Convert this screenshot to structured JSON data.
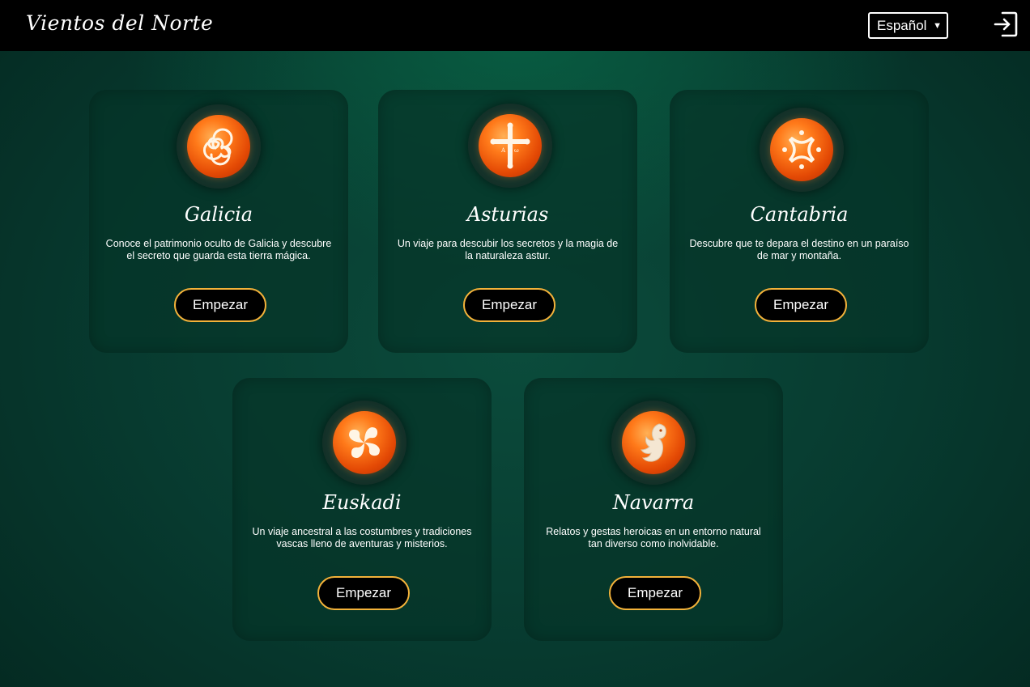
{
  "header": {
    "title": "Vientos del Norte",
    "language": "Español",
    "login_icon": "login-icon"
  },
  "regions": [
    {
      "name": "Galicia",
      "description": "Conoce el patrimonio oculto de Galicia y descubre el secreto que guarda esta tierra mágica.",
      "button": "Empezar",
      "icon": "triskelion-icon"
    },
    {
      "name": "Asturias",
      "description": "Un viaje para descubir los secretos y la magia de la naturaleza  astur.",
      "button": "Empezar",
      "icon": "victory-cross-icon"
    },
    {
      "name": "Cantabria",
      "description": "Descubre que te depara el destino en un paraíso de mar y montaña.",
      "button": "Empezar",
      "icon": "cantabrian-symbol-icon"
    },
    {
      "name": "Euskadi",
      "description": "Un viaje ancestral  a las costumbres y tradiciones vascas lleno de aventuras y misterios.",
      "button": "Empezar",
      "icon": "lauburu-icon"
    },
    {
      "name": "Navarra",
      "description": "Relatos y gestas heroicas en un entorno natural tan diverso como inolvidable.",
      "button": "Empezar",
      "icon": "dragon-icon"
    }
  ],
  "colors": {
    "topbar": "#000000",
    "background": "#073a2f",
    "button_border": "#f3b23a",
    "orb": "#ff7a1a"
  }
}
